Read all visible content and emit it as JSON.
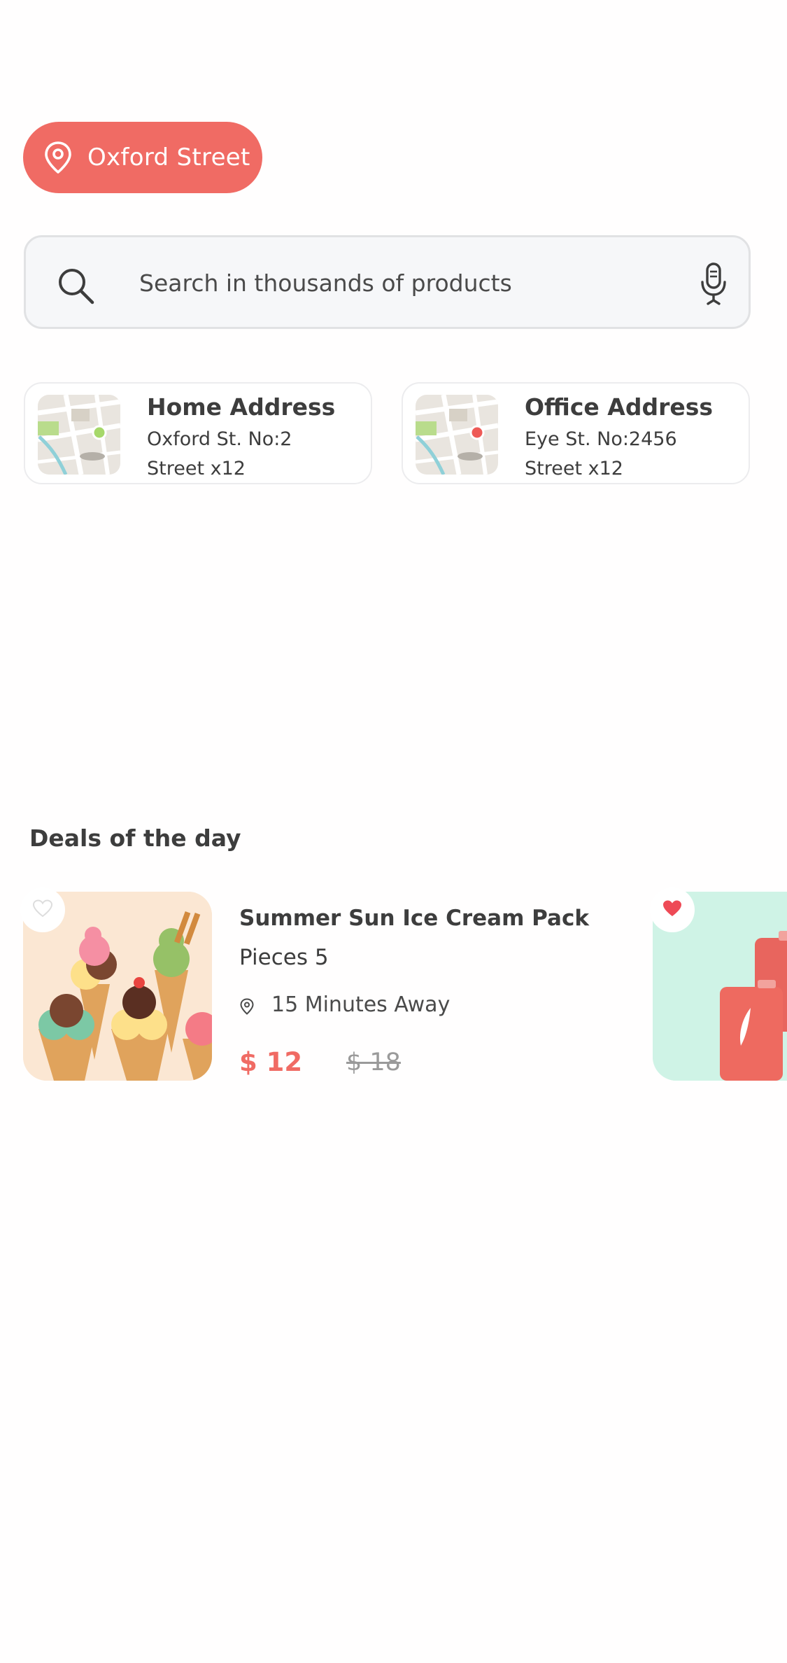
{
  "location": {
    "label": "Oxford Street",
    "icon": "map-pin-icon"
  },
  "search": {
    "placeholder": "Search in thousands of products",
    "icon": "search-icon",
    "voice_icon": "microphone-icon"
  },
  "addresses": [
    {
      "title": "Home Address",
      "line1": "Oxford St. No:2",
      "line2": "Street x12",
      "marker_color": "#a6d86a"
    },
    {
      "title": "Office Address",
      "line1": "Eye St. No:2456",
      "line2": "Street x12",
      "marker_color": "#ee5a56"
    }
  ],
  "deals": {
    "title": "Deals of the day",
    "items": [
      {
        "name": "Summer Sun Ice Cream Pack",
        "pieces": "Pieces 5",
        "distance": "15 Minutes Away",
        "price": "$ 12",
        "old_price": "$ 18",
        "favorite": false
      },
      {
        "favorite": true
      }
    ]
  },
  "colors": {
    "accent": "#f06b64",
    "text": "#3d3d3d",
    "search_bg": "#f6f7f9",
    "card_border": "#ececee"
  }
}
